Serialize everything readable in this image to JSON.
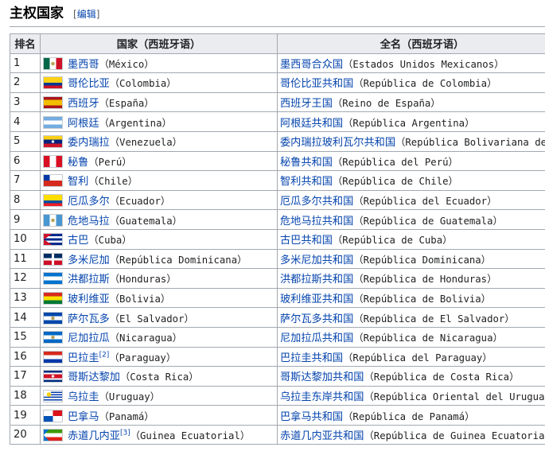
{
  "section": {
    "title": "主权国家",
    "edit_open": "[",
    "edit_label": "编辑",
    "edit_close": "]"
  },
  "table": {
    "headers": [
      "排名",
      "国家（西班牙语）",
      "全名（西班牙语）"
    ],
    "rows": [
      {
        "rank": "1",
        "cn": "墨西哥",
        "es": "（México）",
        "full_cn": "墨西哥合众国",
        "full_es": "（Estados Unidos Mexicanos）",
        "flag": "mexico-flag",
        "ref": ""
      },
      {
        "rank": "2",
        "cn": "哥伦比亚",
        "es": "（Colombia）",
        "full_cn": "哥伦比亚共和国",
        "full_es": "（República de Colombia）",
        "flag": "colombia-flag",
        "ref": ""
      },
      {
        "rank": "3",
        "cn": "西班牙",
        "es": "（España）",
        "full_cn": "西班牙王国",
        "full_es": "（Reino de España）",
        "flag": "spain-flag",
        "ref": ""
      },
      {
        "rank": "4",
        "cn": "阿根廷",
        "es": "（Argentina）",
        "full_cn": "阿根廷共和国",
        "full_es": "（República Argentina）",
        "flag": "argentina-flag",
        "ref": ""
      },
      {
        "rank": "5",
        "cn": "委内瑞拉",
        "es": "（Venezuela）",
        "full_cn": "委内瑞拉玻利瓦尔共和国",
        "full_es": "（República Bolivariana de Venezuela）",
        "flag": "venezuela-flag",
        "ref": ""
      },
      {
        "rank": "6",
        "cn": "秘鲁",
        "es": "（Perú）",
        "full_cn": "秘鲁共和国",
        "full_es": "（República del Perú）",
        "flag": "peru-flag",
        "ref": ""
      },
      {
        "rank": "7",
        "cn": "智利",
        "es": "（Chile）",
        "full_cn": "智利共和国",
        "full_es": "（República de Chile）",
        "flag": "chile-flag",
        "ref": ""
      },
      {
        "rank": "8",
        "cn": "厄瓜多尔",
        "es": "（Ecuador）",
        "full_cn": "厄瓜多尔共和国",
        "full_es": "（República del Ecuador）",
        "flag": "ecuador-flag",
        "ref": ""
      },
      {
        "rank": "9",
        "cn": "危地马拉",
        "es": "（Guatemala）",
        "full_cn": "危地马拉共和国",
        "full_es": "（República de Guatemala）",
        "flag": "guatemala-flag",
        "ref": ""
      },
      {
        "rank": "10",
        "cn": "古巴",
        "es": "（Cuba）",
        "full_cn": "古巴共和国",
        "full_es": "（República de Cuba）",
        "flag": "cuba-flag",
        "ref": ""
      },
      {
        "rank": "11",
        "cn": "多米尼加",
        "es": "（República Dominicana）",
        "full_cn": "多米尼加共和国",
        "full_es": "（República Dominicana）",
        "flag": "dominican-republic-flag",
        "ref": ""
      },
      {
        "rank": "12",
        "cn": "洪都拉斯",
        "es": "（Honduras）",
        "full_cn": "洪都拉斯共和国",
        "full_es": "（República de Honduras）",
        "flag": "honduras-flag",
        "ref": ""
      },
      {
        "rank": "13",
        "cn": "玻利维亚",
        "es": "（Bolivia）",
        "full_cn": "玻利维亚共和国",
        "full_es": "（República de Bolivia）",
        "flag": "bolivia-flag",
        "ref": ""
      },
      {
        "rank": "14",
        "cn": "萨尔瓦多",
        "es": "（El Salvador）",
        "full_cn": "萨尔瓦多共和国",
        "full_es": "（República de El Salvador）",
        "flag": "el-salvador-flag",
        "ref": ""
      },
      {
        "rank": "15",
        "cn": "尼加拉瓜",
        "es": "（Nicaragua）",
        "full_cn": "尼加拉瓜共和国",
        "full_es": "（República de Nicaragua）",
        "flag": "nicaragua-flag",
        "ref": ""
      },
      {
        "rank": "16",
        "cn": "巴拉圭",
        "es": "（Paraguay）",
        "full_cn": "巴拉圭共和国",
        "full_es": "（República del Paraguay）",
        "flag": "paraguay-flag",
        "ref": "[2]"
      },
      {
        "rank": "17",
        "cn": "哥斯达黎加",
        "es": "（Costa Rica）",
        "full_cn": "哥斯达黎加共和国",
        "full_es": "（República de Costa Rica）",
        "flag": "costa-rica-flag",
        "ref": ""
      },
      {
        "rank": "18",
        "cn": "乌拉圭",
        "es": "（Uruguay）",
        "full_cn": "乌拉圭东岸共和国",
        "full_es": "（República Oriental del Uruguay）",
        "flag": "uruguay-flag",
        "ref": ""
      },
      {
        "rank": "19",
        "cn": "巴拿马",
        "es": "（Panamá）",
        "full_cn": "巴拿马共和国",
        "full_es": "（República de Panamá）",
        "flag": "panama-flag",
        "ref": ""
      },
      {
        "rank": "20",
        "cn": "赤道几内亚",
        "es": "（Guinea Ecuatorial）",
        "full_cn": "赤道几内亚共和国",
        "full_es": "（República de Guinea Ecuatorial）",
        "flag": "equatorial-guinea-flag",
        "ref": "[3]"
      }
    ]
  }
}
